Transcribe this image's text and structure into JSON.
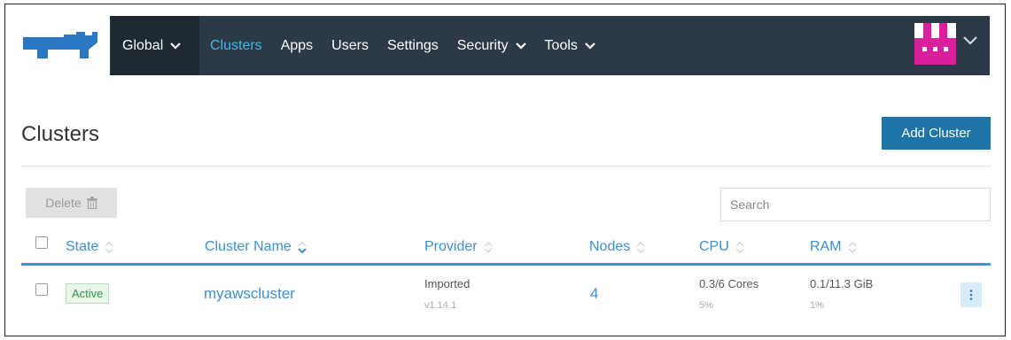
{
  "nav": {
    "global_label": "Global",
    "items": [
      {
        "label": "Clusters",
        "active": true
      },
      {
        "label": "Apps"
      },
      {
        "label": "Users"
      },
      {
        "label": "Settings"
      },
      {
        "label": "Security",
        "dropdown": true
      },
      {
        "label": "Tools",
        "dropdown": true
      }
    ]
  },
  "page": {
    "title": "Clusters",
    "add_button": "Add Cluster",
    "delete_button": "Delete",
    "search_placeholder": "Search"
  },
  "table": {
    "headers": [
      "State",
      "Cluster Name",
      "Provider",
      "Nodes",
      "CPU",
      "RAM"
    ],
    "rows": [
      {
        "state": "Active",
        "name": "myawscluster",
        "provider": "Imported",
        "version": "v1.14.1",
        "nodes": "4",
        "cpu": "0.3/6 Cores",
        "cpu_pct": "5%",
        "ram": "0.1/11.3 GiB",
        "ram_pct": "1%"
      }
    ]
  },
  "colors": {
    "nav_bg": "#2c3a47",
    "accent": "#3d8fcc",
    "primary_button": "#1e73a8",
    "avatar": "#d91f9b",
    "active_state": "#2c9a49"
  }
}
